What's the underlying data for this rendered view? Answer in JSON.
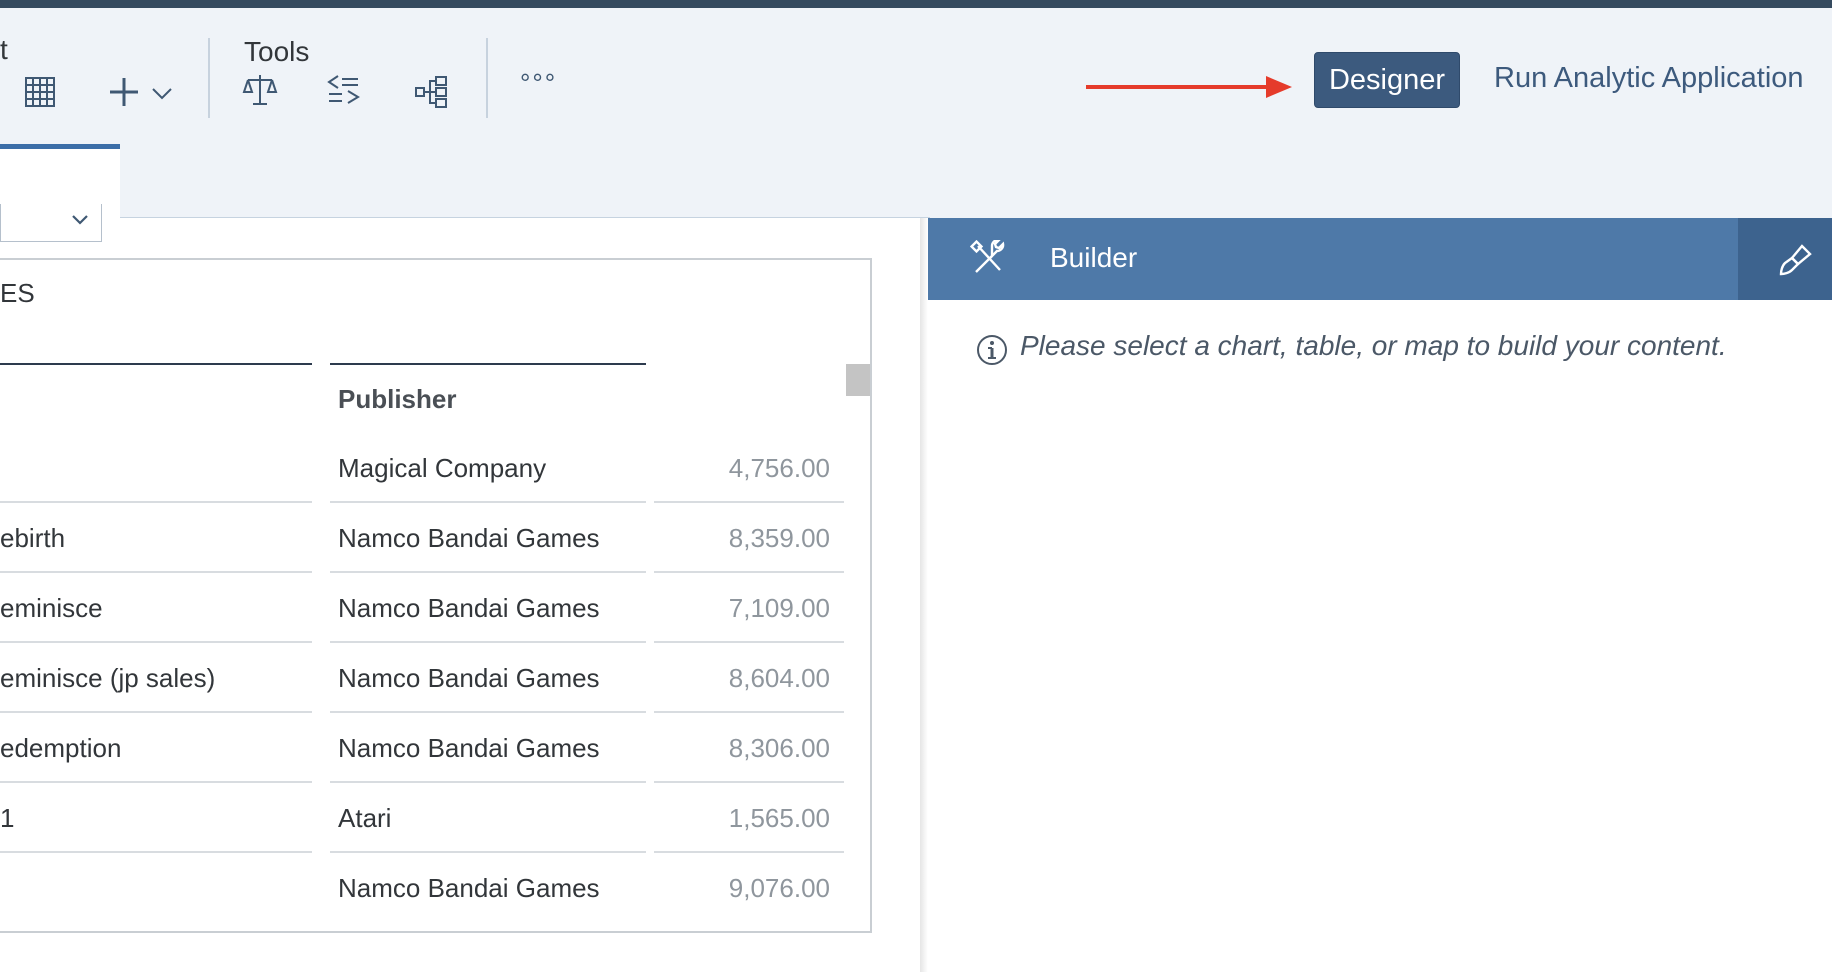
{
  "toolbar": {
    "partial_group_label": "t",
    "tools_group_label": "Tools",
    "more_label": "°°°",
    "designer_label": "Designer",
    "run_label": "Run Analytic Application"
  },
  "table": {
    "title_fragment": "ES",
    "publisher_header": "Publisher",
    "rows": [
      {
        "name": "",
        "publisher": "Magical Company",
        "value": "4,756.00"
      },
      {
        "name": "ebirth",
        "publisher": "Namco Bandai Games",
        "value": "8,359.00"
      },
      {
        "name": "eminisce",
        "publisher": "Namco Bandai Games",
        "value": "7,109.00"
      },
      {
        "name": "eminisce (jp sales)",
        "publisher": "Namco Bandai Games",
        "value": "8,604.00"
      },
      {
        "name": "edemption",
        "publisher": "Namco Bandai Games",
        "value": "8,306.00"
      },
      {
        "name": "1",
        "publisher": "Atari",
        "value": "1,565.00"
      },
      {
        "name": "",
        "publisher": "Namco Bandai Games",
        "value": "9,076.00"
      }
    ]
  },
  "builder": {
    "title": "Builder",
    "message": "Please select a chart, table, or map to build your content."
  },
  "colors": {
    "accent": "#3c5a7e",
    "builder_header": "#4e79a8",
    "arrow": "#e53b2b"
  },
  "icons": [
    "table-icon",
    "add-icon",
    "chevron-down-icon",
    "balance-scale-icon",
    "formula-icon",
    "hierarchy-icon",
    "tools-icon",
    "brush-icon",
    "info-icon"
  ]
}
